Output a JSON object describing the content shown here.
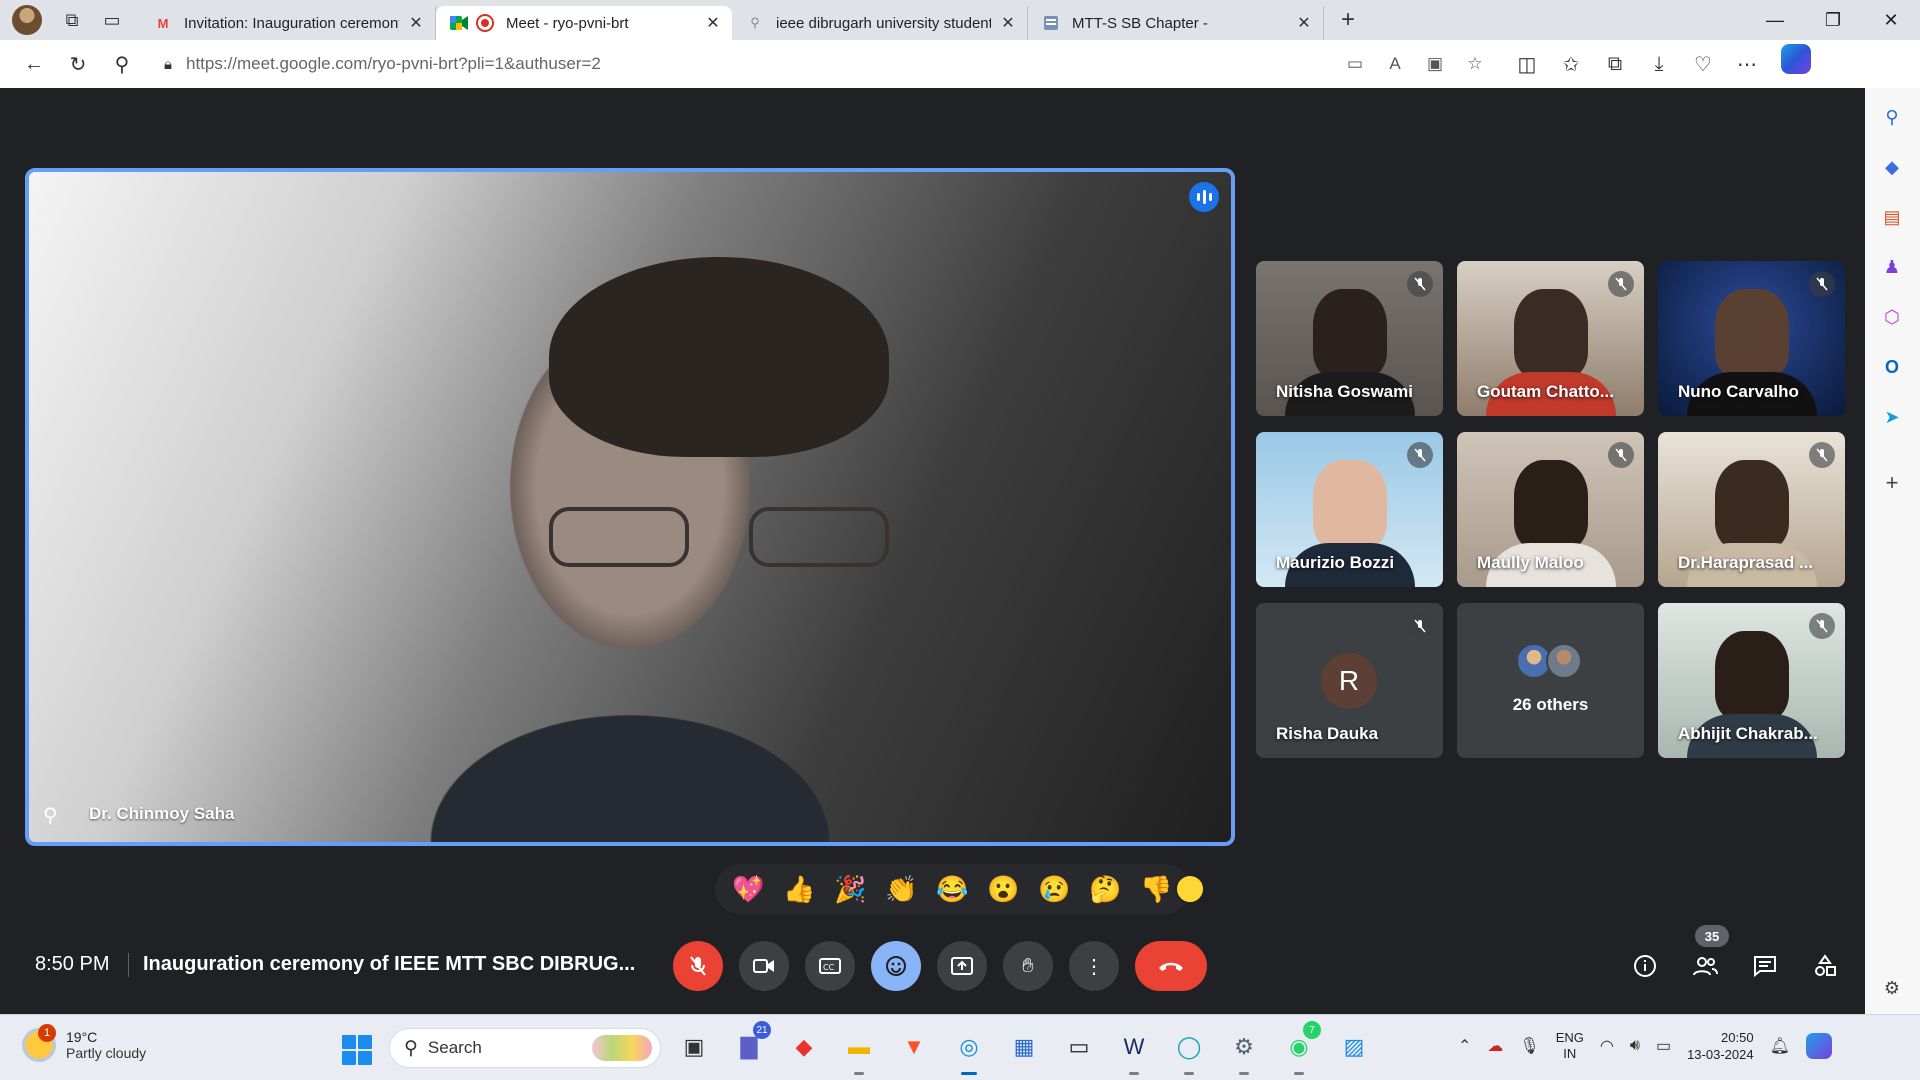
{
  "browser": {
    "tabs": [
      {
        "title": "Invitation: Inauguration ceremony",
        "icon": "gmail-icon"
      },
      {
        "title": "Meet - ryo-pvni-brt",
        "icon": "meet-icon",
        "active": true
      },
      {
        "title": "ieee dibrugarh university student",
        "icon": "search-icon"
      },
      {
        "title": "MTT-S SB Chapter -",
        "icon": "forms-icon"
      }
    ],
    "url": "https://meet.google.com/ryo-pvni-brt?pli=1&authuser=2"
  },
  "meet": {
    "speaker": {
      "name": "Dr. Chinmoy Saha"
    },
    "participants": [
      {
        "name": "Nitisha Goswami",
        "muted": true
      },
      {
        "name": "Goutam Chatto...",
        "muted": true
      },
      {
        "name": "Nuno Carvalho",
        "muted": true
      },
      {
        "name": "Maurizio Bozzi",
        "muted": true
      },
      {
        "name": "Maully Maloo",
        "muted": true
      },
      {
        "name": "Dr.Haraprasad ...",
        "muted": true
      },
      {
        "name": "Risha Dauka",
        "initial": "R",
        "muted": true
      },
      {
        "name": "26 others"
      },
      {
        "name": "Abhijit Chakrab...",
        "muted": true
      }
    ],
    "reactions": [
      "💖",
      "👍",
      "🎉",
      "👏",
      "😂",
      "😮",
      "😢",
      "🤔",
      "👎"
    ],
    "time": "8:50 PM",
    "meeting_title": "Inauguration ceremony of IEEE MTT SBC DIBRUG...",
    "participant_count": "35",
    "colors": {
      "accent": "#8ab4f8",
      "danger": "#ea4335",
      "background": "#202124",
      "tile": "#3c4043"
    }
  },
  "taskbar": {
    "weather": {
      "temp": "19°C",
      "condition": "Partly cloudy",
      "badge": "1"
    },
    "search_placeholder": "Search",
    "teams_badge": "21",
    "whatsapp_badge": "7",
    "lang": {
      "line1": "ENG",
      "line2": "IN"
    },
    "clock": {
      "time": "20:50",
      "date": "13-03-2024"
    }
  }
}
